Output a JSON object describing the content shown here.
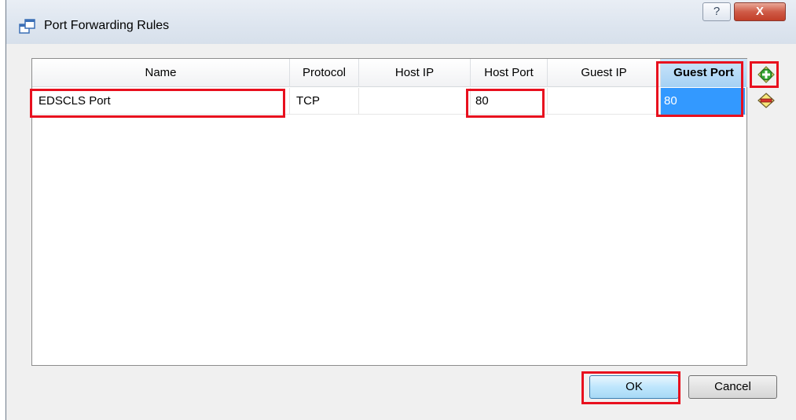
{
  "window": {
    "title": "Port Forwarding Rules",
    "help_label": "?",
    "close_label": "X"
  },
  "table": {
    "columns": [
      "Name",
      "Protocol",
      "Host IP",
      "Host Port",
      "Guest IP",
      "Guest Port"
    ],
    "active_column": "Guest Port",
    "rows": [
      {
        "name": "EDSCLS Port",
        "protocol": "TCP",
        "host_ip": "",
        "host_port": "80",
        "guest_ip": "",
        "guest_port": "80"
      }
    ]
  },
  "side_buttons": {
    "add_icon": "add-rule-icon",
    "remove_icon": "remove-rule-icon"
  },
  "buttons": {
    "ok_label": "OK",
    "cancel_label": "Cancel"
  },
  "colors": {
    "selection": "#3399ff",
    "highlight_box": "#e8101e",
    "active_header": "#a5d1f4"
  }
}
